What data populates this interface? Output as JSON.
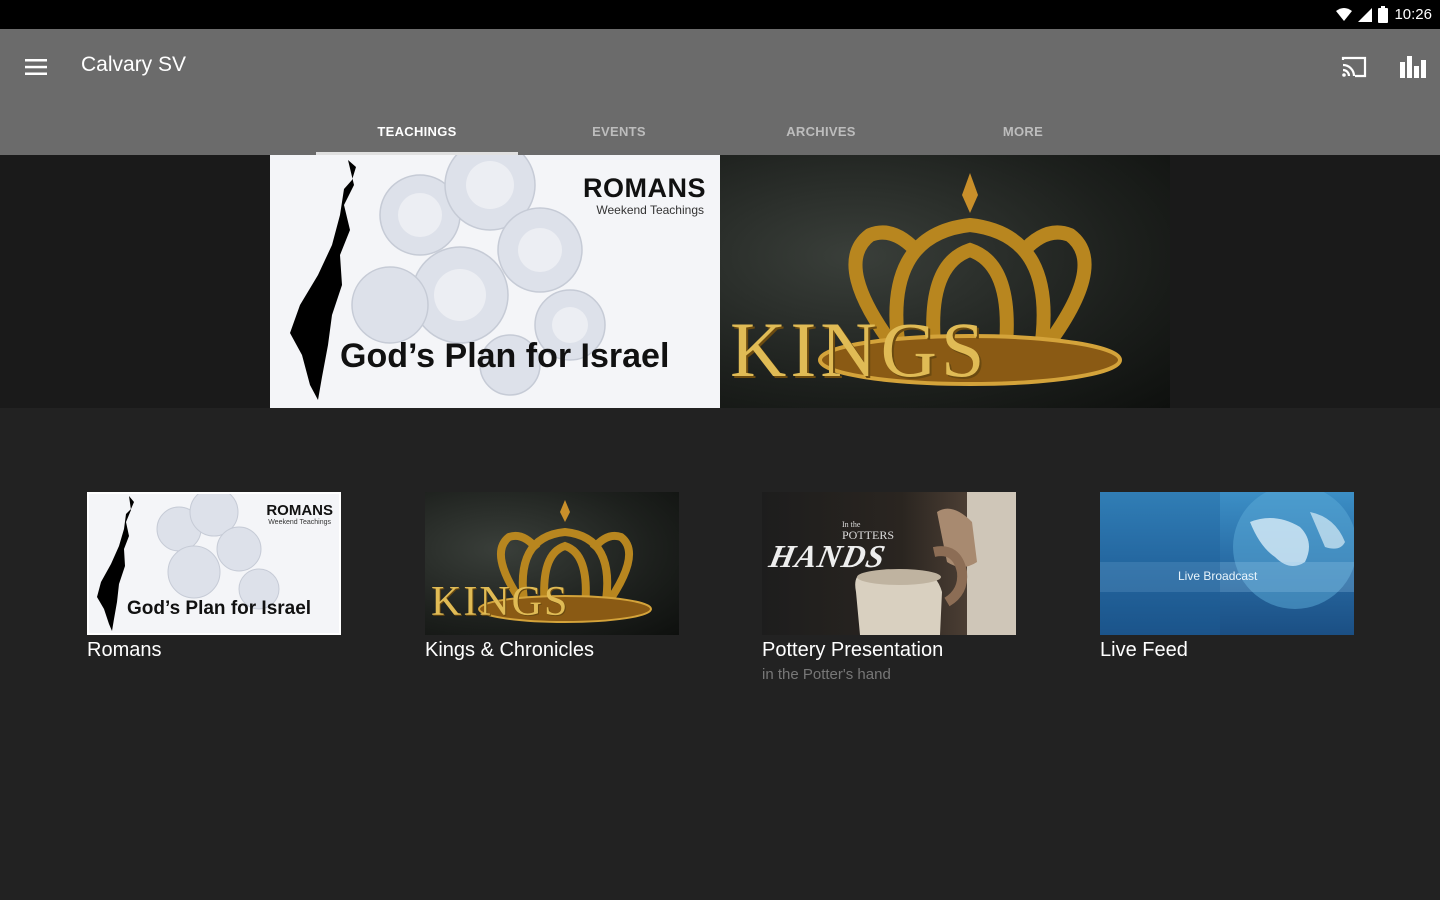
{
  "status_bar": {
    "time": "10:26"
  },
  "app_bar": {
    "title": "Calvary SV"
  },
  "tabs": [
    {
      "label": "TEACHINGS",
      "active": true
    },
    {
      "label": "EVENTS",
      "active": false
    },
    {
      "label": "ARCHIVES",
      "active": false
    },
    {
      "label": "MORE",
      "active": false
    }
  ],
  "hero": {
    "romans": {
      "title": "ROMANS",
      "subtitle": "Weekend Teachings",
      "tagline": "God’s Plan for Israel"
    },
    "kings": {
      "title": "KINGS"
    }
  },
  "cards": [
    {
      "title": "Romans",
      "subtitle": "",
      "art": {
        "title": "ROMANS",
        "subtitle": "Weekend Teachings",
        "tagline": "God’s Plan for Israel"
      }
    },
    {
      "title": "Kings & Chronicles",
      "subtitle": "",
      "art": {
        "title": "KINGS"
      }
    },
    {
      "title": "Pottery Presentation",
      "subtitle": "in the Potter's hand",
      "art": {
        "line1": "In the",
        "line2": "POTTERS",
        "line3": "HANDS"
      }
    },
    {
      "title": "Live Feed",
      "subtitle": "",
      "art": {
        "title": "Live Broadcast"
      }
    }
  ],
  "colors": {
    "app_bar": "#6b6b6b",
    "background": "#222222",
    "hero_band": "#1a1a1a",
    "gold": "#d8a83a"
  },
  "icons": {
    "menu": "hamburger-icon",
    "cast": "cast-icon",
    "stats": "bar-chart-icon"
  }
}
